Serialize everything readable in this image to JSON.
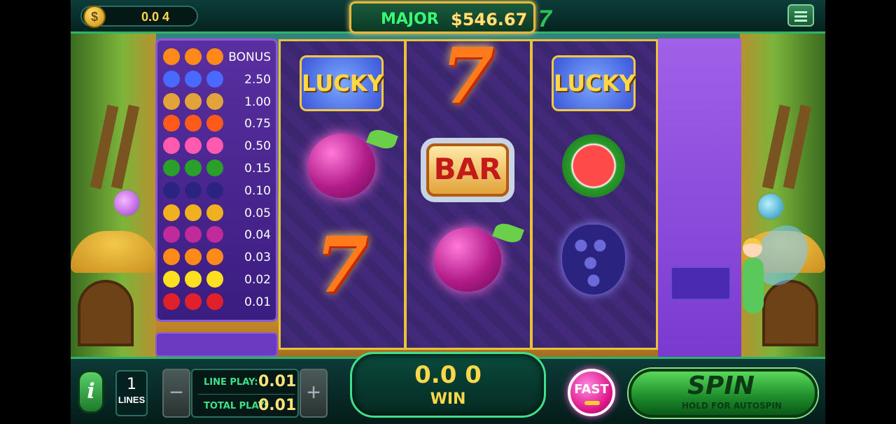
{
  "balance": "0.0 4",
  "jackpot": {
    "label": "MAJOR",
    "value": "$546.67"
  },
  "paytable": {
    "rows": [
      {
        "symbol": "fire-seven",
        "payout": "BONUS",
        "color": "#ff8a1a"
      },
      {
        "symbol": "lucky-star",
        "payout": "2.50",
        "color": "#4a6aff"
      },
      {
        "symbol": "bar",
        "payout": "1.00",
        "color": "#e2a33a"
      },
      {
        "symbol": "seven",
        "payout": "0.75",
        "color": "#ff5a1a"
      },
      {
        "symbol": "dragonfruit",
        "payout": "0.50",
        "color": "#ff5ab0"
      },
      {
        "symbol": "watermelon",
        "payout": "0.15",
        "color": "#2aa02a"
      },
      {
        "symbol": "grapes",
        "payout": "0.10",
        "color": "#2a2480"
      },
      {
        "symbol": "pineapple",
        "payout": "0.05",
        "color": "#f0b020"
      },
      {
        "symbol": "plum",
        "payout": "0.04",
        "color": "#c02a9a"
      },
      {
        "symbol": "orange",
        "payout": "0.03",
        "color": "#ff8a1a"
      },
      {
        "symbol": "lemon",
        "payout": "0.02",
        "color": "#ffe020"
      },
      {
        "symbol": "cherry",
        "payout": "0.01",
        "color": "#e0202a"
      }
    ]
  },
  "reels": {
    "reel1": [
      "LUCKY",
      "plum",
      "7"
    ],
    "reel2": [
      "7",
      "BAR",
      "plum"
    ],
    "reel3": [
      "LUCKY",
      "watermelon",
      "grapes"
    ]
  },
  "controls": {
    "info_label": "i",
    "lines_count": "1",
    "lines_label": "LINES",
    "minus_label": "−",
    "plus_label": "+",
    "line_play_label": "LINE PLAY:",
    "line_play_value": "0.01",
    "total_play_label": "TOTAL PLAY:",
    "total_play_value": "0.01",
    "win_value": "0.0 0",
    "win_label": "WIN",
    "fast_label": "FAST",
    "spin_label": "SPIN",
    "spin_sub": "HOLD FOR AUTOSPIN"
  },
  "colors": {
    "accent_green": "#2fb36a",
    "gold": "#ffd84a",
    "reel_frame": "#e9c23a",
    "panel_purple": "#5a2fa0"
  }
}
